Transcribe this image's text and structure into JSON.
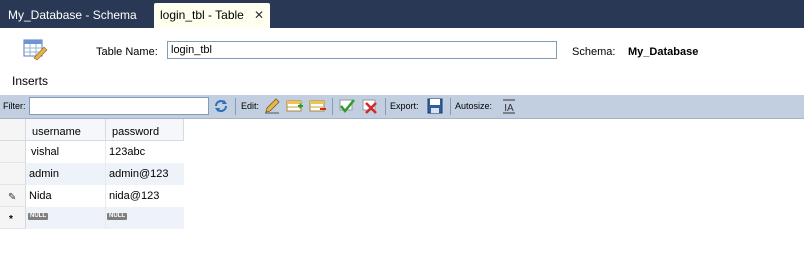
{
  "tabs": [
    {
      "label": "My_Database - Schema"
    },
    {
      "label": "login_tbl - Table",
      "close": "✕"
    }
  ],
  "header": {
    "table_name_label": "Table Name:",
    "table_name_value": "login_tbl",
    "schema_label": "Schema:",
    "schema_value": "My_Database"
  },
  "section": {
    "title": "Inserts"
  },
  "toolbar": {
    "filter_label": "Filter:",
    "filter_value": "",
    "edit_label": "Edit:",
    "export_label": "Export:",
    "autosize_label": "Autosize:",
    "icons": [
      "refresh-icon",
      "edit-pencil-icon",
      "insert-row-icon",
      "delete-row-icon",
      "apply-changes-icon",
      "discard-changes-icon",
      "export-save-icon",
      "autosize-icon"
    ]
  },
  "grid": {
    "columns": [
      "username",
      "password"
    ],
    "rows": [
      {
        "marker": "",
        "username": "vishal",
        "password": "123abc"
      },
      {
        "marker": "",
        "username": "admin",
        "password": "admin@123"
      },
      {
        "marker": "✎",
        "username": "Nida",
        "password": "nida@123"
      },
      {
        "marker": "*",
        "username": "NULL",
        "password": "NULL"
      }
    ]
  },
  "colors": {
    "tabbar": "#293955",
    "toolbar": "#c2cfe0",
    "row_alt": "#eef3fa"
  }
}
